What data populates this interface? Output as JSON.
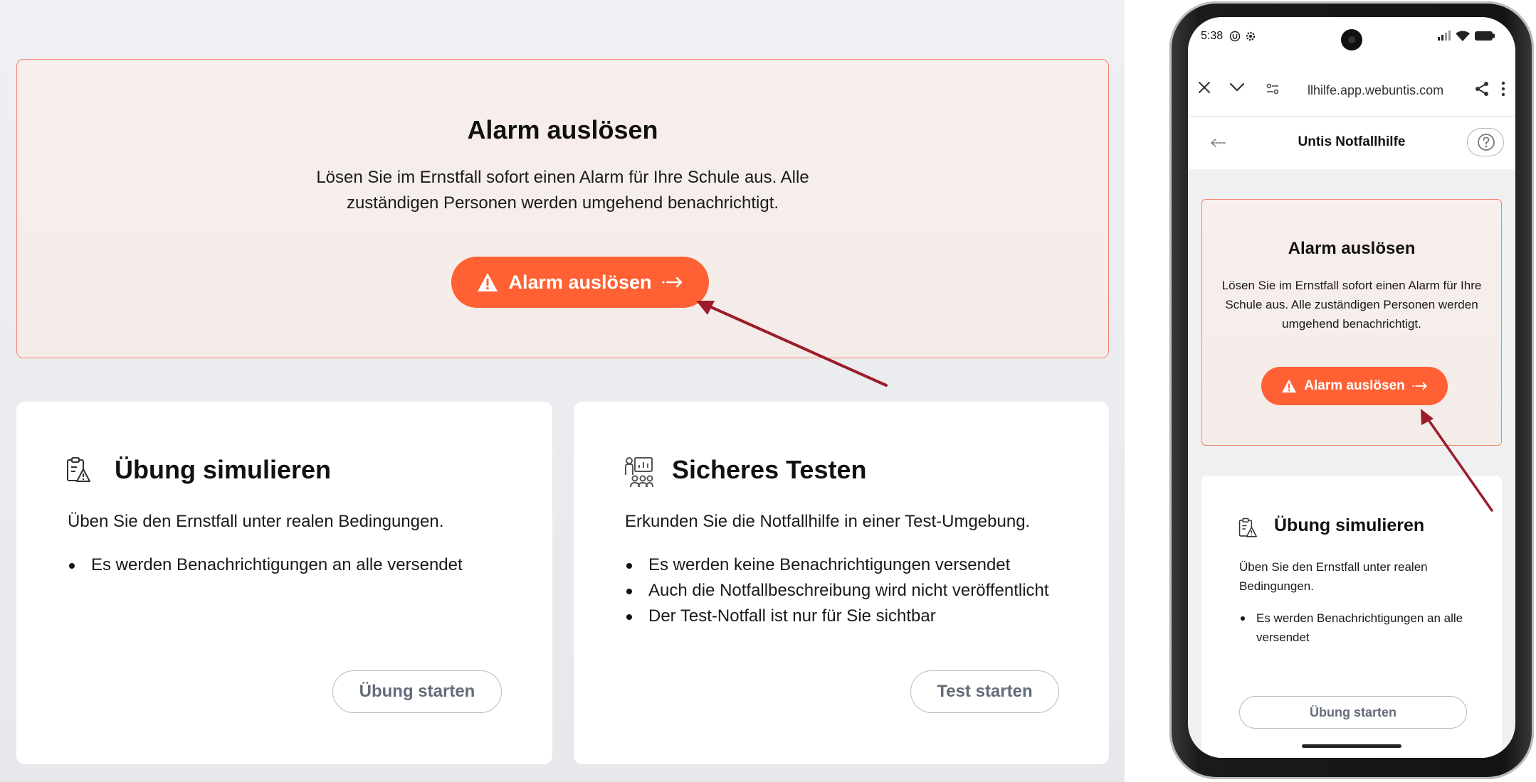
{
  "desktop": {
    "alarm": {
      "title": "Alarm auslösen",
      "description": "Lösen Sie im Ernstfall sofort einen Alarm für Ihre Schule aus. Alle zuständigen Personen werden umgehend benachrichtigt.",
      "button_label": "Alarm auslösen"
    },
    "simulate": {
      "title": "Übung simulieren",
      "description": "Üben Sie den Ernstfall unter realen Bedingungen.",
      "bullets": [
        "Es werden Benachrichtigungen an alle versendet"
      ],
      "button_label": "Übung starten",
      "icon": "clipboard-warning-icon"
    },
    "test": {
      "title": "Sicheres Testen",
      "description": "Erkunden Sie die Notfallhilfe in einer Test-Umgebung.",
      "bullets": [
        "Es werden keine Benachrichtigungen versendet",
        "Auch die Notfallbeschreibung wird nicht veröffentlicht",
        "Der Test-Notfall ist nur für Sie sichtbar"
      ],
      "button_label": "Test starten",
      "icon": "presentation-people-icon"
    }
  },
  "phone": {
    "status_time": "5:38",
    "url": "llhilfe.app.webuntis.com",
    "app_title": "Untis Notfallhilfe",
    "alarm": {
      "title": "Alarm auslösen",
      "description": "Lösen Sie im Ernstfall sofort einen Alarm für Ihre Schule aus. Alle zuständigen Personen werden umgehend benachrichtigt.",
      "button_label": "Alarm auslösen"
    },
    "simulate": {
      "title": "Übung simulieren",
      "description": "Üben Sie den Ernstfall unter realen Bedingungen.",
      "bullets": [
        "Es werden Benachrichtigungen an alle versendet"
      ],
      "button_label": "Übung starten"
    }
  },
  "colors": {
    "accent": "#ff6134",
    "alarm_border": "#f2876d",
    "annotation_arrow": "#9b1c2a"
  }
}
